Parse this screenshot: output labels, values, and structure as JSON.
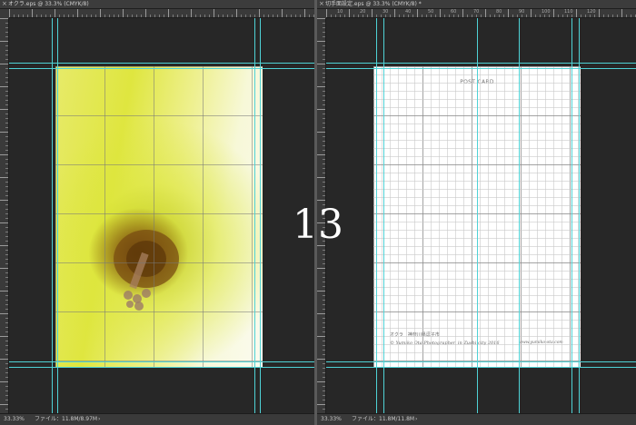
{
  "left_window": {
    "tab_title": "オクラ.eps @ 33.3% (CMYK/8)",
    "close_glyph": "×",
    "zoom": "33.33%",
    "file_info": "ファイル：11.8M/8.97M",
    "arrow": "›"
  },
  "right_window": {
    "tab_title": "切手面設定.eps @ 33.3% (CMYK/8) *",
    "close_glyph": "×",
    "zoom": "33.33%",
    "file_info": "ファイル：11.8M/11.8M",
    "arrow": "›",
    "ruler_labels": [
      "10",
      "20",
      "30",
      "40",
      "50",
      "60",
      "70",
      "80",
      "90",
      "100",
      "110",
      "120"
    ],
    "postcard_label": "POST CARD",
    "credit_line1": "オクラ　神奈川県逗子市",
    "credit_line2": "© Yumiko Ota Photographer, in Zushi city 2016",
    "credit_url": "www.yumiko-ota.com"
  },
  "page_number": "13",
  "colors": {
    "guide": "#4fd2d6",
    "grid": "#a9a9a9",
    "background": "#282828"
  }
}
